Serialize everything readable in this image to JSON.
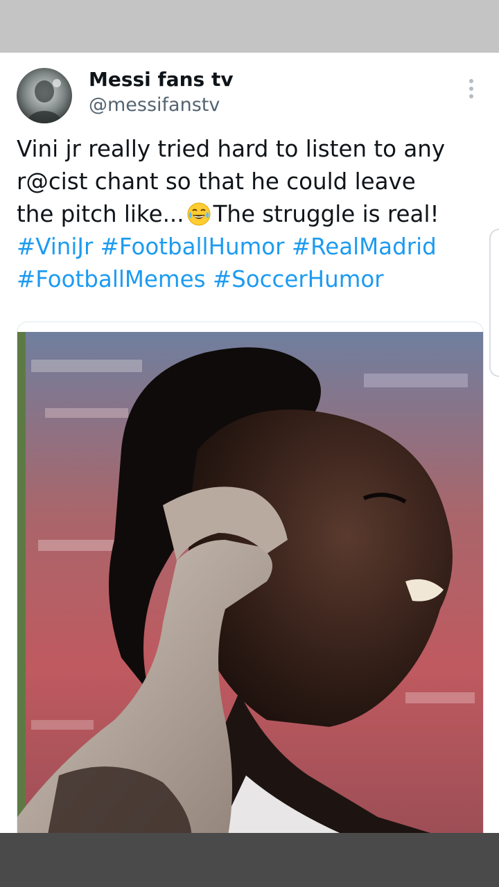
{
  "tweet": {
    "display_name": "Messi fans tv",
    "handle": "@messifanstv",
    "text_lines": [
      "Vini jr really tried hard to listen to any",
      "r@cist chant so that he could leave",
      "the pitch like..."
    ],
    "text_after_emoji": "The struggle is real!",
    "emoji": "face-with-tears-of-joy",
    "hashtags_line1": "#ViniJr #FootballHumor #RealMadrid",
    "hashtags_line2": "#FootballMemes #SoccerHumor",
    "more_icon": "more-vertical-icon",
    "media": {
      "description": "photo of footballer cupping hand to ear"
    }
  },
  "colors": {
    "hashtag": "#1d9bf0",
    "text": "#0f1419",
    "handle": "#536471",
    "top_bar": "#c4c4c4",
    "bottom_bar": "#4a4a4a"
  }
}
